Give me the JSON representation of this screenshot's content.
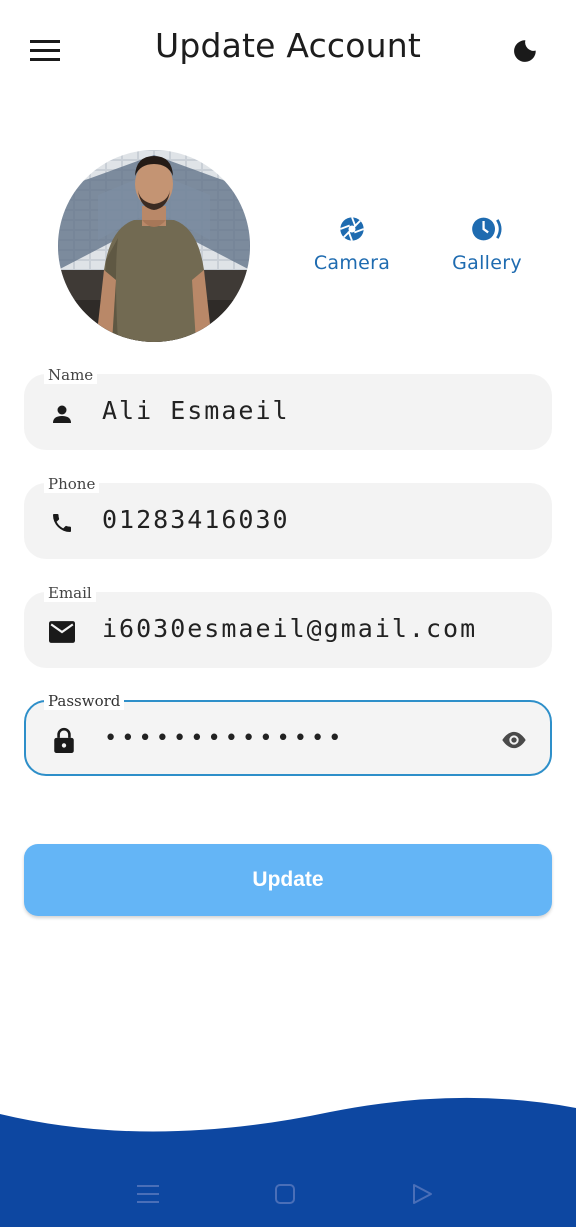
{
  "appbar": {
    "title": "Update Account",
    "menu_icon": "menu-icon",
    "theme_icon": "moon-icon"
  },
  "profile": {
    "avatar": "user-photo",
    "camera_label": "Camera",
    "gallery_label": "Gallery",
    "accent_color": "#1e6bb0"
  },
  "form": {
    "name": {
      "label": "Name",
      "value": "Ali Esmaeil",
      "icon": "person-icon"
    },
    "phone": {
      "label": "Phone",
      "value": "01283416030",
      "icon": "phone-icon"
    },
    "email": {
      "label": "Email",
      "value": "i6030esmaeil@gmail.com",
      "icon": "mail-icon"
    },
    "password": {
      "label": "Password",
      "value": "••••••••••••••",
      "icon": "lock-icon",
      "toggle_icon": "eye-icon"
    }
  },
  "update_button": {
    "label": "Update",
    "color": "#64b5f6"
  },
  "colors": {
    "wave": "#0d47a1",
    "focus_border": "#2e8fc9"
  },
  "system_nav": {
    "items": [
      "menu-nav-icon",
      "home-nav-icon",
      "back-nav-icon"
    ]
  }
}
